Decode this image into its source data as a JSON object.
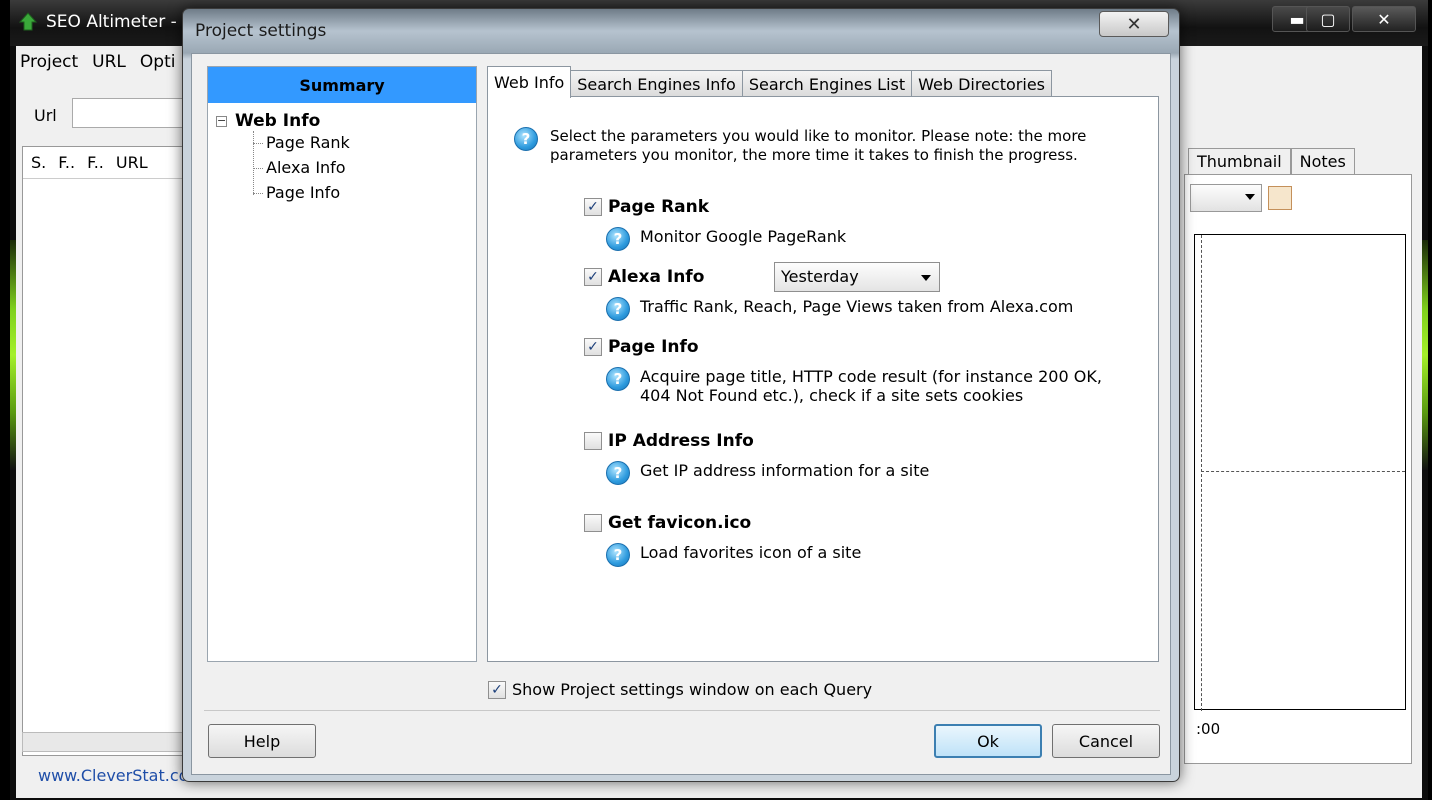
{
  "app": {
    "title": "SEO Altimeter - d",
    "menu": [
      "Project",
      "URL",
      "Opti"
    ],
    "url_label": "Url",
    "list_columns": [
      "S.",
      "F..",
      "F..",
      "URL"
    ],
    "footer_link": "www.CleverStat.com",
    "right_tabs": [
      "Thumbnail",
      "Notes"
    ],
    "chart_tick": ":00",
    "window_buttons": {
      "minimize": "▬",
      "maximize": "▢",
      "close": "✕"
    }
  },
  "dialog": {
    "title": "Project settings",
    "close_label": "✕",
    "tree": {
      "header": "Summary",
      "root": {
        "toggle": "−",
        "label": "Web Info"
      },
      "children": [
        "Page Rank",
        "Alexa Info",
        "Page Info"
      ]
    },
    "tabs": [
      "Web Info",
      "Search Engines Info",
      "Search Engines List",
      "Web Directories"
    ],
    "active_tab": "Web Info",
    "intro": "Select the parameters you would like to monitor. Please note: the more parameters you monitor, the more time it takes to finish the progress.",
    "help_glyph": "?",
    "options": [
      {
        "label": "Page Rank",
        "checked": true,
        "mark": "✓",
        "desc": "Monitor Google PageRank"
      },
      {
        "label": "Alexa Info",
        "checked": true,
        "mark": "✓",
        "desc": "Traffic Rank, Reach, Page Views taken from Alexa.com"
      },
      {
        "label": "Page Info",
        "checked": true,
        "mark": "✓",
        "desc": "Acquire page title, HTTP code result (for instance 200 OK, 404 Not Found etc.), check if a site sets cookies"
      },
      {
        "label": "IP Address Info",
        "checked": false,
        "mark": "",
        "desc": "Get IP address information for a site"
      },
      {
        "label": "Get favicon.ico",
        "checked": false,
        "mark": "",
        "desc": "Load favorites icon of a site"
      }
    ],
    "alexa_period": "Yesterday",
    "show_on_query": {
      "label": "Show Project settings window on each Query",
      "checked": true,
      "mark": "✓"
    },
    "buttons": {
      "help": "Help",
      "ok": "Ok",
      "cancel": "Cancel"
    }
  }
}
